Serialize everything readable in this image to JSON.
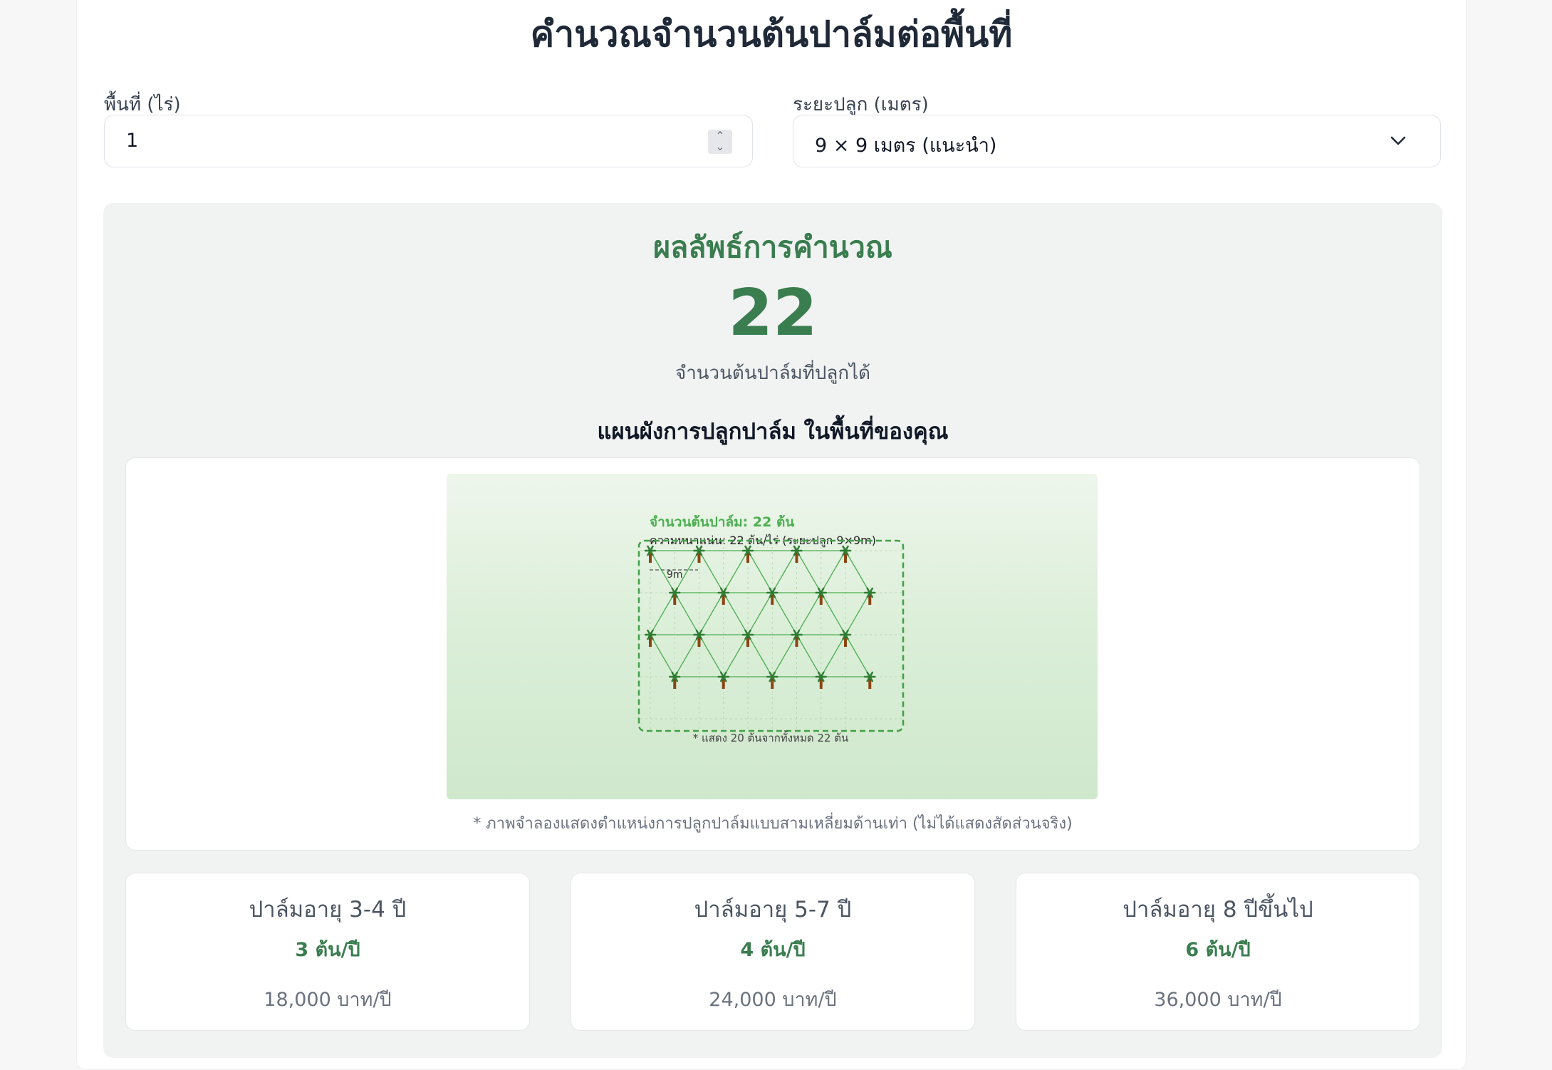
{
  "page": {
    "title": "คำนวณจำนวนต้นปาล์มต่อพื้นที่"
  },
  "form": {
    "area_label": "พื้นที่ (ไร่)",
    "area_value": "1",
    "spacing_label": "ระยะปลูก (เมตร)",
    "spacing_value": "9 × 9 เมตร (แนะนำ)"
  },
  "result": {
    "heading": "ผลลัพธ์การคำนวณ",
    "tree_count": "22",
    "tree_count_label": "จำนวนต้นปาล์มที่ปลูกได้",
    "plan_heading": "แผนผังการปลูกปาล์ม ในพื้นที่ของคุณ",
    "plan_note": "* ภาพจำลองแสดงตำแหน่งการปลูกปาล์มแบบสามเหลี่ยมด้านเท่า (ไม่ได้แสดงสัดส่วนจริง)"
  },
  "diagram": {
    "count_text": "จำนวนต้นปาล์ม: 22 ต้น",
    "density_text": "ความหนาแน่น: 22 ต้น/ไร่ (ระยะปลูก 9×9m)",
    "spacing_marker": "9m",
    "footnote": "* แสดง 20 ต้นจากทั้งหมด 22 ต้น",
    "rows": 4,
    "trees_per_row": 5,
    "colors": {
      "accent": "#4caf50",
      "canopy": "#2e7d32",
      "trunk": "#8b4513",
      "boundary": "#43a047"
    }
  },
  "age_cards": [
    {
      "title": "ปาล์มอายุ 3-4 ปี",
      "trees": "3 ต้น/ปี",
      "income": "18,000 บาท/ปี"
    },
    {
      "title": "ปาล์มอายุ 5-7 ปี",
      "trees": "4 ต้น/ปี",
      "income": "24,000 บาท/ปี"
    },
    {
      "title": "ปาล์มอายุ 8 ปีขึ้นไป",
      "trees": "6 ต้น/ปี",
      "income": "36,000 บาท/ปี"
    }
  ],
  "theme": {
    "primary": "#3a7d4f",
    "panel_bg": "#f1f3f2"
  }
}
